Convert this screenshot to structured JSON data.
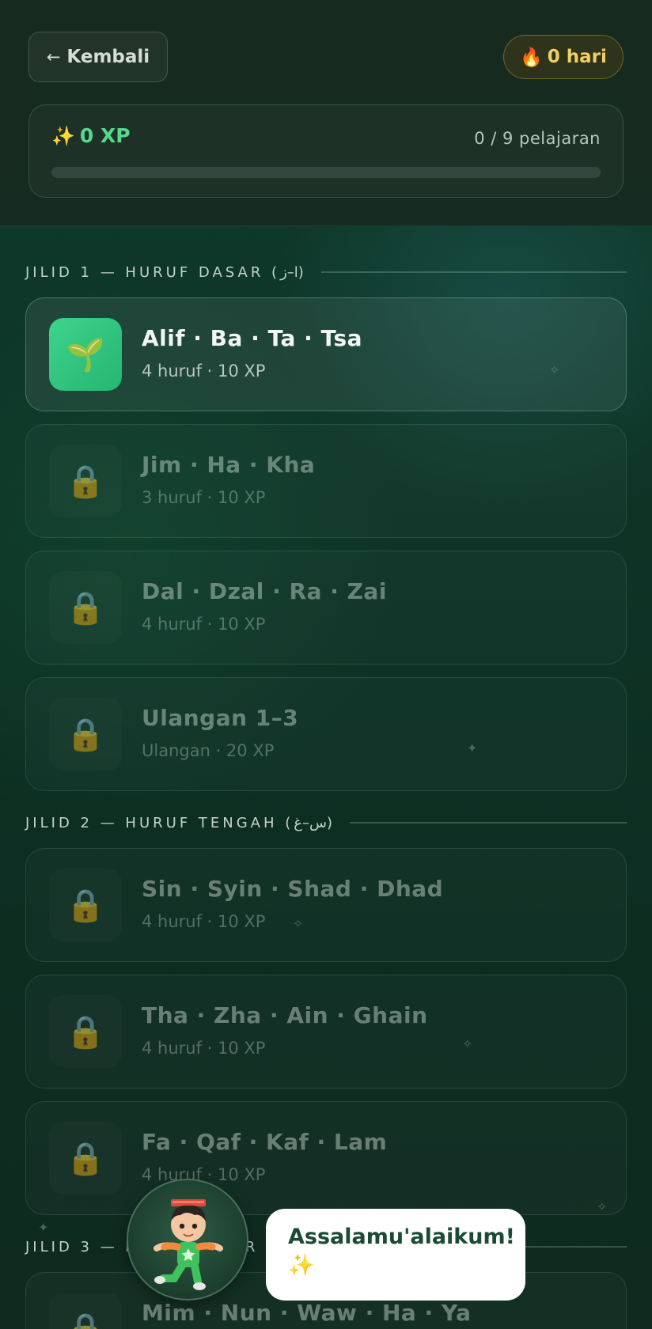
{
  "header": {
    "back_label": "Kembali",
    "back_arrow": "←",
    "streak_icon": "🔥",
    "streak_label": "0 hari"
  },
  "progress": {
    "xp_icon": "✨",
    "xp_label": "0 XP",
    "lessons_label": "0 / 9 pelajaran",
    "fraction_complete": 0,
    "accent_color": "#56d98e"
  },
  "sections": [
    {
      "title": "JILID 1 — HURUF DASAR (ا–ز)"
    },
    {
      "title": "JILID 2 — HURUF TENGAH (س–غ)"
    },
    {
      "title": "JILID 3 — HURUF AKHIR"
    }
  ],
  "lessons": [
    {
      "title": "Alif · Ba · Ta · Tsa",
      "sub": "4 huruf · 10 XP",
      "icon": "🌱",
      "state": "active"
    },
    {
      "title": "Jim · Ha · Kha",
      "sub": "3 huruf · 10 XP",
      "icon": "🔒",
      "state": "locked"
    },
    {
      "title": "Dal · Dzal · Ra · Zai",
      "sub": "4 huruf · 10 XP",
      "icon": "🔒",
      "state": "locked"
    },
    {
      "title": "Ulangan 1–3",
      "sub": "Ulangan · 20 XP",
      "icon": "🔒",
      "state": "locked"
    },
    {
      "title": "Sin · Syin · Shad · Dhad",
      "sub": "4 huruf · 10 XP",
      "icon": "🔒",
      "state": "locked"
    },
    {
      "title": "Tha · Zha · Ain · Ghain",
      "sub": "4 huruf · 10 XP",
      "icon": "🔒",
      "state": "locked"
    },
    {
      "title": "Fa · Qaf · Kaf · Lam",
      "sub": "4 huruf · 10 XP",
      "icon": "🔒",
      "state": "locked"
    },
    {
      "title": "Mim · Nun · Waw · Ha · Ya",
      "sub": "",
      "icon": "🔒",
      "state": "locked"
    }
  ],
  "mascot": {
    "greeting": "Assalamu'alaikum! ✨"
  }
}
